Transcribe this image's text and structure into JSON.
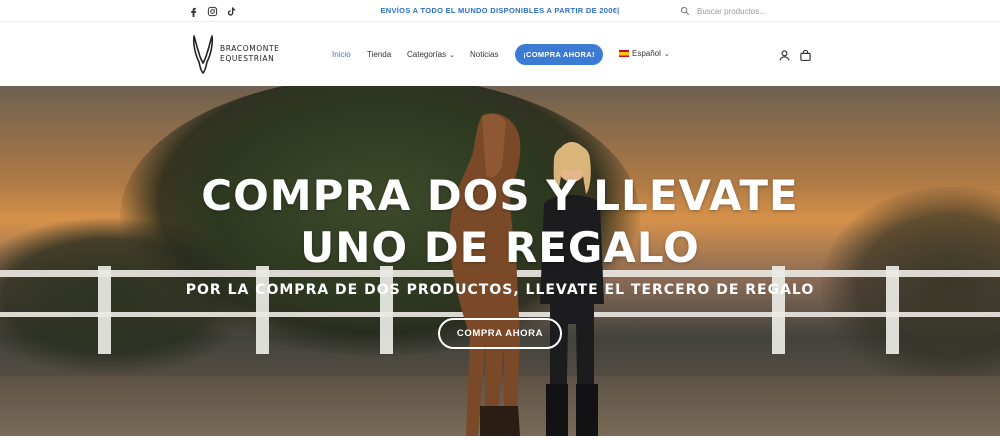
{
  "topbar": {
    "promo": "ENVÍOS A TODO EL MUNDO DISPONIBLES A PARTIR DE 200€|",
    "search_placeholder": "Buscar productos...",
    "social_icons": [
      "facebook-icon",
      "instagram-icon",
      "tiktok-icon"
    ]
  },
  "header": {
    "logo_line1": "BRACOMONTE",
    "logo_line2": "EQUESTRIAN",
    "nav": [
      {
        "label": "Inicio",
        "active": true
      },
      {
        "label": "Tienda"
      },
      {
        "label": "Categorías",
        "has_dropdown": true
      },
      {
        "label": "Noticias"
      }
    ],
    "cta": "¡COMPRA AHORA!",
    "language": "Español",
    "accent_color": "#3b7bd4"
  },
  "hero": {
    "headline_line1": "COMPRA DOS Y LLEVATE",
    "headline_line2": "UNO DE REGALO",
    "subheadline": "POR LA COMPRA DE DOS PRODUCTOS, LLEVATE EL TERCERO DE REGALO",
    "button": "COMPRA AHORA"
  }
}
